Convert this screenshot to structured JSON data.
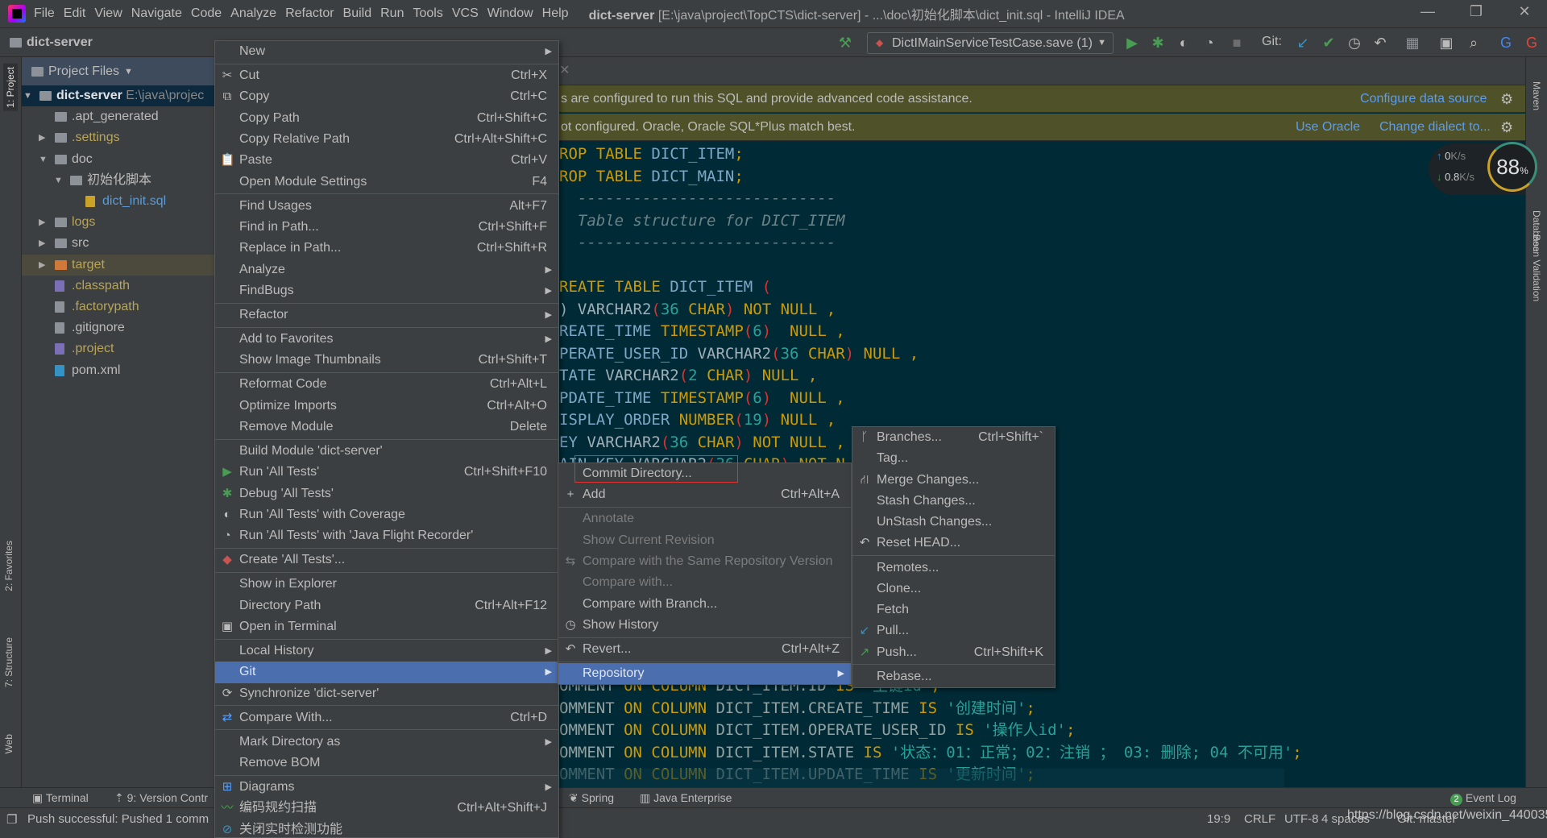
{
  "titlebar": {
    "menus": [
      "File",
      "Edit",
      "View",
      "Navigate",
      "Code",
      "Analyze",
      "Refactor",
      "Build",
      "Run",
      "Tools",
      "VCS",
      "Window",
      "Help"
    ],
    "project": "dict-server",
    "title_rest": " [E:\\java\\project\\TopCTS\\dict-server] - ...\\doc\\初始化脚本\\dict_init.sql - IntelliJ IDEA",
    "minimize": "—",
    "restore": "❐",
    "close": "✕"
  },
  "navbar": {
    "breadcrumb": "dict-server",
    "run_config": "DictIMainServiceTestCase.save (1)",
    "git_label": "Git:"
  },
  "left_strip": {
    "project": "1: Project",
    "favorites": "2: Favorites",
    "structure": "7: Structure",
    "web": "Web"
  },
  "right_strip": {
    "maven": "Maven",
    "database": "Database",
    "bean": "Bean Validation"
  },
  "project_panel": {
    "header": "Project Files",
    "tree": [
      {
        "label": "dict-server",
        "extra": "E:\\java\\projec",
        "depth": 0,
        "expanded": true,
        "icon": "module-folder",
        "color": "#dfe1e5",
        "bold": true,
        "selected": true
      },
      {
        "label": ".apt_generated",
        "depth": 1,
        "icon": "folder",
        "color": "#bbbbbb"
      },
      {
        "label": ".settings",
        "depth": 1,
        "collapsed": true,
        "icon": "folder",
        "color": "#b8a55a"
      },
      {
        "label": "doc",
        "depth": 1,
        "expanded": true,
        "icon": "folder",
        "color": "#bbbbbb"
      },
      {
        "label": "初始化脚本",
        "depth": 2,
        "expanded": true,
        "icon": "folder",
        "color": "#bbbbbb"
      },
      {
        "label": "dict_init.sql",
        "depth": 3,
        "icon": "sql-file",
        "color": "#5c9bd6"
      },
      {
        "label": "logs",
        "depth": 1,
        "collapsed": true,
        "icon": "folder",
        "color": "#b8a55a"
      },
      {
        "label": "src",
        "depth": 1,
        "collapsed": true,
        "icon": "folder",
        "color": "#bbbbbb"
      },
      {
        "label": "target",
        "depth": 1,
        "collapsed": true,
        "icon": "excluded-folder",
        "color": "#b8a55a",
        "highlighted": true
      },
      {
        "label": ".classpath",
        "depth": 1,
        "icon": "eclipse-file",
        "color": "#b8a55a"
      },
      {
        "label": ".factorypath",
        "depth": 1,
        "icon": "file",
        "color": "#b8a55a"
      },
      {
        "label": ".gitignore",
        "depth": 1,
        "icon": "gitignore-file",
        "color": "#bbbbbb"
      },
      {
        "label": ".project",
        "depth": 1,
        "icon": "eclipse-file",
        "color": "#b8a55a"
      },
      {
        "label": "pom.xml",
        "depth": 1,
        "icon": "maven-file",
        "color": "#bbbbbb"
      }
    ]
  },
  "editor": {
    "banner1": {
      "text": "s are configured to run this SQL and provide advanced code assistance.",
      "link1": "Configure data source"
    },
    "banner2": {
      "text": "ot configured. Oracle, Oracle SQL*Plus match best.",
      "link1": "Use Oracle",
      "link2": "Change dialect to..."
    },
    "lines": [
      [
        [
          "k",
          "ROP TABLE "
        ],
        [
          "id",
          "DICT_ITEM"
        ],
        [
          "k",
          ";"
        ]
      ],
      [
        [
          "k",
          "ROP TABLE "
        ],
        [
          "id",
          "DICT_MAIN"
        ],
        [
          "k",
          ";"
        ]
      ],
      [
        [
          "c",
          "  ----------------------------"
        ]
      ],
      [
        [
          "c",
          "  Table structure for DICT_ITEM"
        ]
      ],
      [
        [
          "c",
          "  ----------------------------"
        ]
      ],
      [],
      [
        [
          "k",
          "REATE TABLE "
        ],
        [
          "id",
          "DICT_ITEM "
        ],
        [
          "p",
          "("
        ]
      ],
      [
        [
          "ty",
          ") VARCHAR2"
        ],
        [
          "p",
          "("
        ],
        [
          "n",
          "36 "
        ],
        [
          "k",
          "CHAR"
        ],
        [
          "p",
          ")"
        ],
        [
          "k",
          " NOT NULL "
        ],
        [
          "k",
          ","
        ]
      ],
      [
        [
          "id",
          "REATE_TIME "
        ],
        [
          "k",
          "TIMESTAMP"
        ],
        [
          "p",
          "("
        ],
        [
          "n",
          "6"
        ],
        [
          "p",
          ")"
        ],
        [
          "k",
          "  NULL "
        ],
        [
          "k",
          ","
        ]
      ],
      [
        [
          "id",
          "PERATE_USER_ID "
        ],
        [
          "ty",
          "VARCHAR2"
        ],
        [
          "p",
          "("
        ],
        [
          "n",
          "36 "
        ],
        [
          "k",
          "CHAR"
        ],
        [
          "p",
          ")"
        ],
        [
          "k",
          " NULL "
        ],
        [
          "k",
          ","
        ]
      ],
      [
        [
          "id",
          "TATE "
        ],
        [
          "ty",
          "VARCHAR2"
        ],
        [
          "p",
          "("
        ],
        [
          "n",
          "2 "
        ],
        [
          "k",
          "CHAR"
        ],
        [
          "p",
          ")"
        ],
        [
          "k",
          " NULL "
        ],
        [
          "k",
          ","
        ]
      ],
      [
        [
          "id",
          "PDATE_TIME "
        ],
        [
          "k",
          "TIMESTAMP"
        ],
        [
          "p",
          "("
        ],
        [
          "n",
          "6"
        ],
        [
          "p",
          ")"
        ],
        [
          "k",
          "  NULL "
        ],
        [
          "k",
          ","
        ]
      ],
      [
        [
          "id",
          "ISPLAY_ORDER "
        ],
        [
          "k",
          "NUMBER"
        ],
        [
          "p",
          "("
        ],
        [
          "n",
          "19"
        ],
        [
          "p",
          ")"
        ],
        [
          "k",
          " NULL "
        ],
        [
          "k",
          ","
        ]
      ],
      [
        [
          "id",
          "EY "
        ],
        [
          "ty",
          "VARCHAR2"
        ],
        [
          "p",
          "("
        ],
        [
          "n",
          "36 "
        ],
        [
          "k",
          "CHAR"
        ],
        [
          "p",
          ")"
        ],
        [
          "k",
          " NOT NULL "
        ],
        [
          "k",
          ","
        ]
      ],
      [
        [
          "id",
          "AIN_KEY "
        ],
        [
          "ty",
          "VARCHAR2"
        ],
        [
          "p",
          "("
        ],
        [
          "n",
          "36 "
        ],
        [
          "k",
          "CHAR"
        ],
        [
          "p",
          ")"
        ],
        [
          "k",
          " NOT N"
        ]
      ],
      [],
      [],
      [],
      [],
      [],
      [],
      [],
      [],
      [],
      [
        [
          "pl",
          "OMMENT "
        ],
        [
          "k",
          "ON COLUMN "
        ],
        [
          "pl",
          "DICT_ITEM.ID "
        ],
        [
          "k",
          "IS "
        ],
        [
          "s",
          "'主键id'"
        ],
        [
          "k",
          ";"
        ]
      ],
      [
        [
          "pl",
          "OMMENT "
        ],
        [
          "k",
          "ON COLUMN "
        ],
        [
          "pl",
          "DICT_ITEM.CREATE_TIME "
        ],
        [
          "k",
          "IS "
        ],
        [
          "s",
          "'创建时间'"
        ],
        [
          "k",
          ";"
        ]
      ],
      [
        [
          "pl",
          "OMMENT "
        ],
        [
          "k",
          "ON COLUMN "
        ],
        [
          "pl",
          "DICT_ITEM.OPERATE_USER_ID "
        ],
        [
          "k",
          "IS "
        ],
        [
          "s",
          "'操作人id'"
        ],
        [
          "k",
          ";"
        ]
      ],
      [
        [
          "pl",
          "OMMENT "
        ],
        [
          "k",
          "ON COLUMN "
        ],
        [
          "pl",
          "DICT_ITEM.STATE "
        ],
        [
          "k",
          "IS "
        ],
        [
          "s",
          "'状态：01：正常；02：注销 ； 03: 删除; 04 不可用'"
        ],
        [
          "k",
          ";"
        ]
      ],
      [
        [
          "pl",
          "OMMENT "
        ],
        [
          "k",
          "ON COLUMN "
        ],
        [
          "pl",
          "DICT_ITEM.UPDATE_TIME "
        ],
        [
          "k",
          "IS "
        ],
        [
          "s",
          "'更新时间'"
        ],
        [
          "k",
          ";"
        ]
      ]
    ]
  },
  "network": {
    "up": "0",
    "down": "0.8",
    "unit": "K/s",
    "percent": "88",
    "percent_sign": "%"
  },
  "context_menu": [
    {
      "label": "New",
      "arrow": true
    },
    {
      "sep": true
    },
    {
      "label": "Cut",
      "shortcut": "Ctrl+X",
      "icon": "✂"
    },
    {
      "label": "Copy",
      "shortcut": "Ctrl+C",
      "icon": "⧉"
    },
    {
      "label": "Copy Path",
      "shortcut": "Ctrl+Shift+C"
    },
    {
      "label": "Copy Relative Path",
      "shortcut": "Ctrl+Alt+Shift+C"
    },
    {
      "label": "Paste",
      "shortcut": "Ctrl+V",
      "icon": "📋"
    },
    {
      "label": "Open Module Settings",
      "shortcut": "F4"
    },
    {
      "sep": true
    },
    {
      "label": "Find Usages",
      "shortcut": "Alt+F7"
    },
    {
      "label": "Find in Path...",
      "shortcut": "Ctrl+Shift+F"
    },
    {
      "label": "Replace in Path...",
      "shortcut": "Ctrl+Shift+R"
    },
    {
      "label": "Analyze",
      "arrow": true
    },
    {
      "label": "FindBugs",
      "arrow": true
    },
    {
      "sep": true
    },
    {
      "label": "Refactor",
      "arrow": true
    },
    {
      "sep": true
    },
    {
      "label": "Add to Favorites",
      "arrow": true
    },
    {
      "label": "Show Image Thumbnails",
      "shortcut": "Ctrl+Shift+T"
    },
    {
      "sep": true
    },
    {
      "label": "Reformat Code",
      "shortcut": "Ctrl+Alt+L"
    },
    {
      "label": "Optimize Imports",
      "shortcut": "Ctrl+Alt+O"
    },
    {
      "label": "Remove Module",
      "shortcut": "Delete"
    },
    {
      "sep": true
    },
    {
      "label": "Build Module 'dict-server'"
    },
    {
      "label": "Run 'All Tests'",
      "shortcut": "Ctrl+Shift+F10",
      "icon": "▶",
      "iconColor": "#499c54"
    },
    {
      "label": "Debug 'All Tests'",
      "icon": "✱",
      "iconColor": "#499c54"
    },
    {
      "label": "Run 'All Tests' with Coverage",
      "icon": "◐"
    },
    {
      "label": "Run 'All Tests' with 'Java Flight Recorder'",
      "icon": "◔"
    },
    {
      "sep": true
    },
    {
      "label": "Create 'All Tests'...",
      "icon": "◆",
      "iconColor": "#c75450"
    },
    {
      "sep": true
    },
    {
      "label": "Show in Explorer"
    },
    {
      "label": "Directory Path",
      "shortcut": "Ctrl+Alt+F12"
    },
    {
      "label": "Open in Terminal",
      "icon": "▣"
    },
    {
      "sep": true
    },
    {
      "label": "Local History",
      "arrow": true
    },
    {
      "label": "Git",
      "arrow": true,
      "highlight": true
    },
    {
      "label": "Synchronize 'dict-server'",
      "icon": "⟳"
    },
    {
      "sep": true
    },
    {
      "label": "Compare With...",
      "shortcut": "Ctrl+D",
      "icon": "⇄",
      "iconColor": "#589df6"
    },
    {
      "sep": true
    },
    {
      "label": "Mark Directory as",
      "arrow": true
    },
    {
      "label": "Remove BOM"
    },
    {
      "sep": true
    },
    {
      "label": "Diagrams",
      "arrow": true,
      "icon": "⊞",
      "iconColor": "#589df6"
    },
    {
      "label": "编码规约扫描",
      "shortcut": "Ctrl+Alt+Shift+J",
      "icon": "〰",
      "iconColor": "#49a84c"
    },
    {
      "label": "关闭实时检测功能",
      "icon": "⊘",
      "iconColor": "#3592c4"
    }
  ],
  "git_menu": [
    {
      "label": "Commit Directory...",
      "boxed": true
    },
    {
      "label": "Add",
      "shortcut": "Ctrl+Alt+A",
      "icon": "+"
    },
    {
      "sep": true
    },
    {
      "label": "Annotate",
      "disabled": true
    },
    {
      "label": "Show Current Revision",
      "disabled": true
    },
    {
      "label": "Compare with the Same Repository Version",
      "disabled": true,
      "icon": "⇆"
    },
    {
      "label": "Compare with...",
      "disabled": true
    },
    {
      "label": "Compare with Branch..."
    },
    {
      "label": "Show History",
      "icon": "◷"
    },
    {
      "sep": true
    },
    {
      "label": "Revert...",
      "shortcut": "Ctrl+Alt+Z",
      "icon": "↶"
    },
    {
      "sep": true
    },
    {
      "label": "Repository",
      "arrow": true,
      "highlight": true
    }
  ],
  "repo_menu": [
    {
      "label": "Branches...",
      "shortcut": "Ctrl+Shift+`",
      "icon": "ᚴ"
    },
    {
      "label": "Tag..."
    },
    {
      "label": "Merge Changes...",
      "icon": "⛙"
    },
    {
      "label": "Stash Changes..."
    },
    {
      "label": "UnStash Changes..."
    },
    {
      "label": "Reset HEAD...",
      "icon": "↶"
    },
    {
      "sep": true
    },
    {
      "label": "Remotes..."
    },
    {
      "label": "Clone..."
    },
    {
      "label": "Fetch"
    },
    {
      "label": "Pull...",
      "icon": "↙",
      "iconColor": "#3592c4"
    },
    {
      "label": "Push...",
      "shortcut": "Ctrl+Shift+K",
      "icon": "↗",
      "iconColor": "#499c54"
    },
    {
      "sep": true
    },
    {
      "label": "Rebase..."
    }
  ],
  "bottom_tools": {
    "terminal": "Terminal",
    "vcs": "9: Version Contr",
    "spring": "Spring",
    "javaee": "Java Enterprise",
    "event_count": "2",
    "event_log": "Event Log"
  },
  "status": {
    "message": "Push successful: Pushed 1 comm",
    "position": "19:9",
    "line_sep": "CRLF",
    "encoding": "UTF-8",
    "indent": "4 spaces",
    "git": "Git: master",
    "watermark": "https://blog.csdn.net/weixin_44003528"
  }
}
